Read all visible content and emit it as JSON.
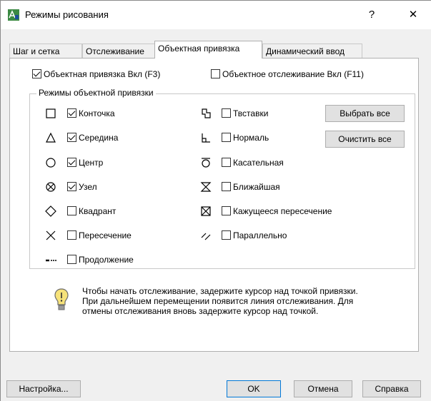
{
  "window": {
    "title": "Режимы рисования",
    "help_btn": "?",
    "close_btn": "✕"
  },
  "tabs": [
    {
      "label": "Шаг и сетка"
    },
    {
      "label": "Отслеживание"
    },
    {
      "label": "Объектная привязка"
    },
    {
      "label": "Динамический ввод"
    }
  ],
  "osnap_on": {
    "label": "Объектная привязка Вкл (F3)",
    "checked": true
  },
  "otrack_on": {
    "label": "Объектное отслеживание Вкл (F11)",
    "checked": false
  },
  "group_title": "Режимы объектной привязки",
  "modes_left": [
    {
      "label": "Конточка",
      "checked": true,
      "icon": "square-icon"
    },
    {
      "label": "Середина",
      "checked": true,
      "icon": "triangle-icon"
    },
    {
      "label": "Центр",
      "checked": true,
      "icon": "circle-icon"
    },
    {
      "label": "Узел",
      "checked": true,
      "icon": "node-icon"
    },
    {
      "label": "Квадрант",
      "checked": false,
      "icon": "diamond-icon"
    },
    {
      "label": "Пересечение",
      "checked": false,
      "icon": "cross-icon"
    },
    {
      "label": "Продолжение",
      "checked": false,
      "icon": "extension-icon"
    }
  ],
  "modes_right": [
    {
      "label": "Твставки",
      "checked": false,
      "icon": "insertion-icon"
    },
    {
      "label": "Нормаль",
      "checked": false,
      "icon": "perpendicular-icon"
    },
    {
      "label": "Касательная",
      "checked": false,
      "icon": "tangent-icon"
    },
    {
      "label": "Ближайшая",
      "checked": false,
      "icon": "nearest-icon"
    },
    {
      "label": "Кажущееся пересечение",
      "checked": false,
      "icon": "apparent-intersection-icon"
    },
    {
      "label": "Параллельно",
      "checked": false,
      "icon": "parallel-icon"
    }
  ],
  "select_all": "Выбрать все",
  "clear_all": "Очистить все",
  "info_lines": [
    "Чтобы начать отслеживание, задержите курсор над точкой привязки.",
    "При дальнейшем перемещении появится линия отслеживания. Для",
    "отмены отслеживания вновь задержите курсор над точкой."
  ],
  "buttons": {
    "settings": "Настройка...",
    "ok": "OK",
    "cancel": "Отмена",
    "help": "Справка"
  }
}
